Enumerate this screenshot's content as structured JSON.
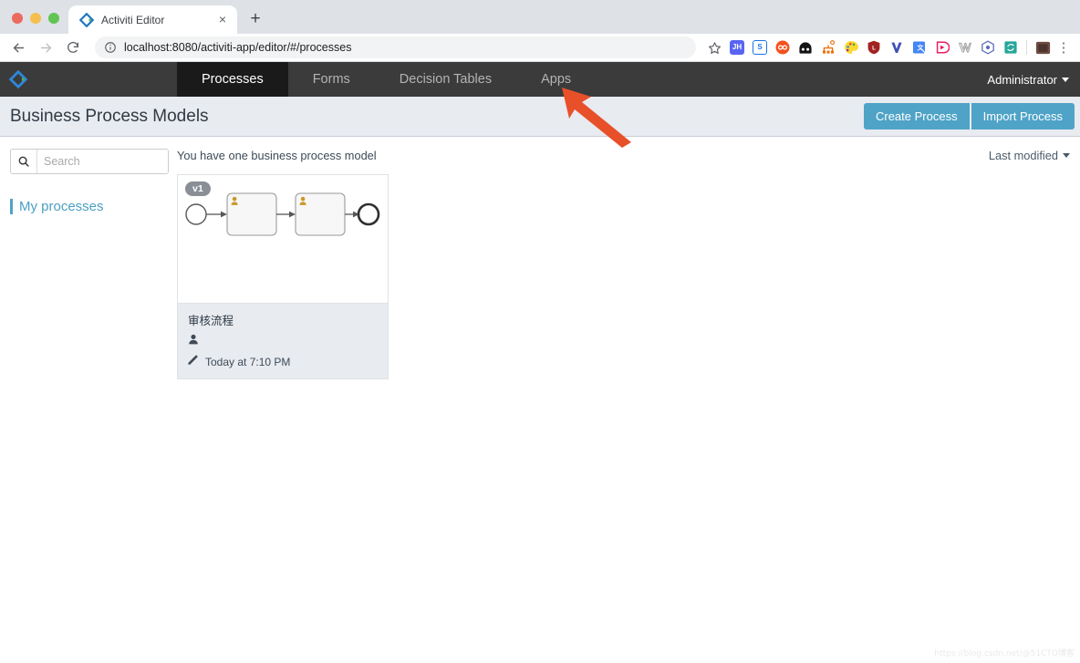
{
  "browser": {
    "window_controls": [
      "close",
      "minimize",
      "maximize"
    ],
    "tab": {
      "title": "Activiti Editor",
      "favicon": "activiti-diamond-icon",
      "close_label": "×"
    },
    "new_tab_label": "+",
    "back_label": "←",
    "forward_label": "→",
    "reload_label": "⟳",
    "url": "localhost:8080/activiti-app/editor/#/processes",
    "url_info_icon": "info-circle-icon",
    "bookmark_icon": "star-icon",
    "extensions": [
      {
        "name": "jh-extension-icon",
        "label": "JH",
        "color": "#5865f2"
      },
      {
        "name": "s-extension-icon",
        "label": "S",
        "color": "#1a73e8"
      },
      {
        "name": "infinity-extension-icon",
        "label": "",
        "color": "#f4511e"
      },
      {
        "name": "dark-reader-extension-icon",
        "label": "",
        "color": "#141414"
      },
      {
        "name": "sitemap-extension-icon",
        "label": "",
        "color": "#ef6c00"
      },
      {
        "name": "palette-extension-icon",
        "label": "",
        "color": "#fdd835"
      },
      {
        "name": "lastpass-extension-icon",
        "label": "",
        "color": "#a32121"
      },
      {
        "name": "v-extension-icon",
        "label": "V",
        "color": "#3f51b5"
      },
      {
        "name": "translate-extension-icon",
        "label": "",
        "color": "#4285f4"
      },
      {
        "name": "play-extension-icon",
        "label": "",
        "color": "#e91e63"
      },
      {
        "name": "w-extension-icon",
        "label": "W",
        "color": "#9e9e9e"
      },
      {
        "name": "cube-extension-icon",
        "label": "",
        "color": "#5c6bc0"
      },
      {
        "name": "sync-extension-icon",
        "label": "",
        "color": "#26a69a"
      }
    ],
    "profile_icon": "user-avatar-icon",
    "menu_icon": "kebab-menu-icon"
  },
  "app_nav": {
    "logo": "activiti-logo-icon",
    "tabs": [
      {
        "label": "Processes",
        "active": true
      },
      {
        "label": "Forms",
        "active": false
      },
      {
        "label": "Decision Tables",
        "active": false
      },
      {
        "label": "Apps",
        "active": false
      }
    ],
    "user": "Administrator",
    "user_caret": "chevron-down-icon"
  },
  "header": {
    "title": "Business Process Models",
    "create_button": "Create Process",
    "import_button": "Import Process",
    "accent_color": "#4fa3c7"
  },
  "sidebar": {
    "search_placeholder": "Search",
    "search_value": "",
    "search_icon": "search-icon",
    "items": [
      {
        "label": "My processes",
        "active": true
      }
    ]
  },
  "main": {
    "count_text": "You have one business process model",
    "sort_label": "Last modified",
    "sort_caret": "chevron-down-icon",
    "cards": [
      {
        "version": "v1",
        "name": "审核流程",
        "author_icon": "person-icon",
        "author": "",
        "edit_icon": "pencil-icon",
        "modified": "Today at 7:10 PM",
        "diagram": {
          "type": "bpmn",
          "nodes": [
            {
              "kind": "start-event",
              "label": ""
            },
            {
              "kind": "user-task",
              "label": ""
            },
            {
              "kind": "user-task",
              "label": ""
            },
            {
              "kind": "end-event",
              "label": ""
            }
          ]
        }
      }
    ]
  },
  "annotation": {
    "arrow": "red-arrow-pointing-to-apps-tab",
    "color": "#e8502a"
  },
  "watermark": "https://blog.csdn.net/@51CTO博客"
}
